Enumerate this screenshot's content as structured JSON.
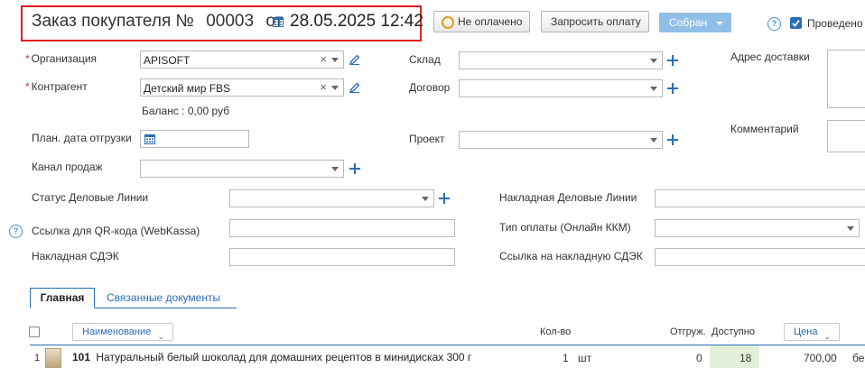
{
  "header": {
    "title_prefix": "Заказ покупателя №",
    "number": "00003",
    "from_label": "от",
    "date": "28.05.2025 12:42"
  },
  "toolbar": {
    "payment_status": "Не оплачено",
    "request_payment": "Запросить оплату",
    "status_button": "Собран",
    "posted_label": "Проведено"
  },
  "form": {
    "organization": {
      "label": "Организация",
      "value": "APISOFT"
    },
    "counterparty": {
      "label": "Контрагент",
      "value": "Детский мир FBS"
    },
    "balance": "Баланс : 0,00 руб",
    "ship_date": {
      "label": "План. дата отгрузки",
      "value": ""
    },
    "sales_channel": {
      "label": "Канал продаж",
      "value": ""
    },
    "warehouse": {
      "label": "Склад",
      "value": ""
    },
    "contract": {
      "label": "Договор",
      "value": ""
    },
    "project": {
      "label": "Проект",
      "value": ""
    },
    "delivery_address": {
      "label": "Адрес доставки"
    },
    "comment": {
      "label": "Комментарий"
    },
    "dl_status": {
      "label": "Статус Деловые Линии",
      "value": ""
    },
    "qr_link": {
      "label": "Ссылка для QR-кода (WebKassa)",
      "value": ""
    },
    "cdek_invoice": {
      "label": "Накладная СДЭК",
      "value": ""
    },
    "dl_invoice": {
      "label": "Накладная Деловые Линии",
      "value": ""
    },
    "payment_type": {
      "label": "Тип оплаты (Онлайн ККМ)",
      "value": ""
    },
    "cdek_link": {
      "label": "Ссылка на накладную СДЭК",
      "value": ""
    }
  },
  "tabs": [
    {
      "label": "Главная",
      "active": true
    },
    {
      "label": "Связанные документы",
      "active": false
    }
  ],
  "table": {
    "headers": {
      "name": "Наименование",
      "qty": "Кол-во",
      "shipped": "Отгруж.",
      "available": "Доступно",
      "price": "Цена"
    },
    "rows": [
      {
        "index": "1",
        "code": "101",
        "name": "Натуральный белый шоколад для домашних рецептов в минидисках 300 г",
        "qty": "1",
        "unit": "шт",
        "shipped": "0",
        "available": "18",
        "price": "700,00",
        "extra": "бе"
      }
    ]
  },
  "colors": {
    "accent": "#2a6db5",
    "highlight_border": "#e02020",
    "status_button": "#8fbfe6",
    "available_bg": "#e3f0d9"
  }
}
